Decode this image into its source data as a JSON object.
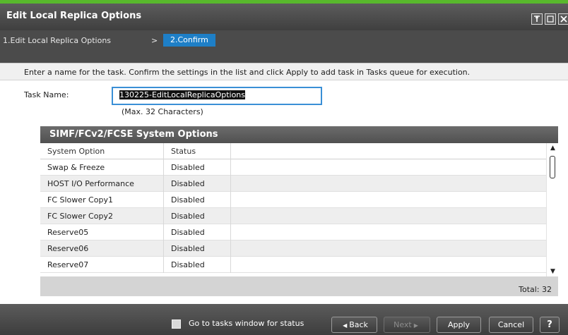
{
  "window": {
    "title": "Edit Local Replica Options",
    "buttons": [
      "pin-icon",
      "maximize-icon",
      "close-icon"
    ]
  },
  "wizard": {
    "step1": "1.Edit Local Replica Options",
    "separator": ">",
    "step2": "2.Confirm"
  },
  "instruction": "Enter a name for the task. Confirm the settings in the list and click Apply to add task in Tasks queue for execution.",
  "task": {
    "label": "Task Name:",
    "value": "130225-EditLocalReplicaOptions",
    "hint": "(Max. 32 Characters)"
  },
  "table": {
    "title": "SIMF/FCv2/FCSE System Options",
    "columns": [
      "System Option",
      "Status"
    ],
    "rows": [
      {
        "option": "Swap & Freeze",
        "status": "Disabled"
      },
      {
        "option": "HOST I/O Performance",
        "status": "Disabled"
      },
      {
        "option": "FC Slower Copy1",
        "status": "Disabled"
      },
      {
        "option": "FC Slower Copy2",
        "status": "Disabled"
      },
      {
        "option": "Reserve05",
        "status": "Disabled"
      },
      {
        "option": "Reserve06",
        "status": "Disabled"
      },
      {
        "option": "Reserve07",
        "status": "Disabled"
      }
    ],
    "total": "Total:  32"
  },
  "footer": {
    "go_to_tasks": "Go to tasks window for status",
    "back": "Back",
    "next": "Next",
    "apply": "Apply",
    "cancel": "Cancel",
    "help": "?"
  },
  "colors": {
    "accent_green": "#58b82c",
    "selected_step": "#1e7fc7",
    "input_focus": "#3a8fd6"
  }
}
